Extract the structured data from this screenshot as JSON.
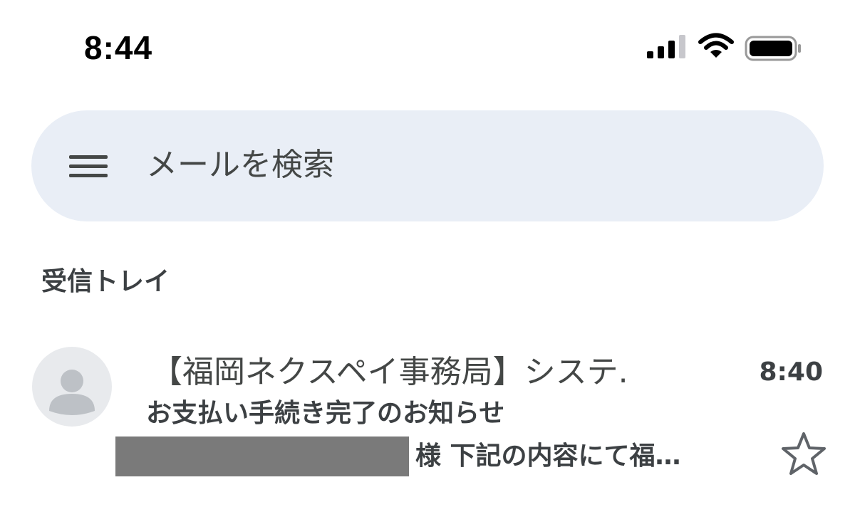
{
  "status_bar": {
    "time": "8:44",
    "icons": [
      "cellular-signal-icon",
      "wifi-icon",
      "battery-icon"
    ]
  },
  "search": {
    "placeholder": "メールを検索",
    "menu_icon": "hamburger-menu-icon"
  },
  "inbox": {
    "label": "受信トレイ"
  },
  "emails": [
    {
      "sender": "【福岡ネクスペイ事務局】システ.",
      "time": "8:40",
      "subject": "お支払い手続き完了のお知らせ",
      "snippet": "様 下記の内容にて福…",
      "sender_redacted": true,
      "starred": false,
      "avatar_icon": "default-person-avatar-icon",
      "star_icon": "star-outline-icon"
    }
  ],
  "colors": {
    "search_bar_bg": "#e9eef6",
    "text_primary": "#3c4043",
    "text_secondary": "#444746",
    "redaction": "#7a7a7a",
    "avatar_bg": "#e8eaed"
  }
}
